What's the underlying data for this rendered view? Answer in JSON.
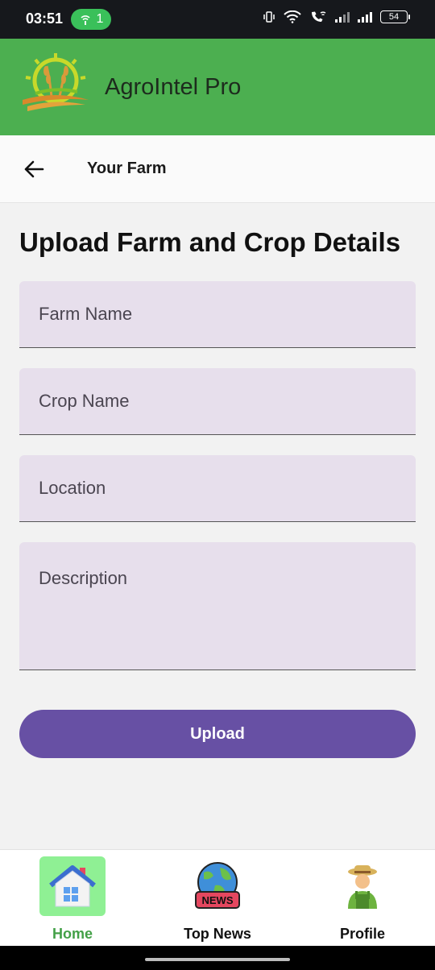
{
  "status_bar": {
    "time": "03:51",
    "hotspot_count": "1",
    "battery": "54"
  },
  "app_bar": {
    "title": "AgroIntel Pro",
    "logo_icon": "wheat-sun-logo"
  },
  "sub_header": {
    "back_icon": "arrow-left-icon",
    "title": "Your Farm"
  },
  "form": {
    "heading": "Upload Farm and Crop Details",
    "farm_name_placeholder": "Farm Name",
    "crop_name_placeholder": "Crop Name",
    "location_placeholder": "Location",
    "description_placeholder": "Description",
    "upload_label": "Upload"
  },
  "bottom_nav": {
    "items": [
      {
        "label": "Home",
        "icon": "home-icon",
        "active": true
      },
      {
        "label": "Top News",
        "icon": "news-globe-icon",
        "active": false
      },
      {
        "label": "Profile",
        "icon": "farmer-avatar-icon",
        "active": false
      }
    ]
  },
  "colors": {
    "app_bar": "#4caf50",
    "field_bg": "#e7dfec",
    "button": "#6750a4",
    "active_nav_bg": "#8ff094",
    "active_nav_label": "#43a047"
  }
}
